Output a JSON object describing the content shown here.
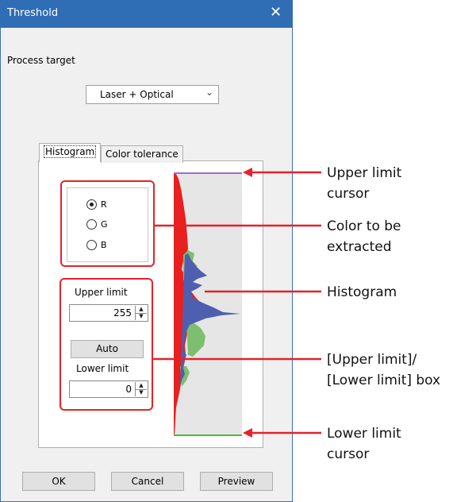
{
  "window": {
    "title": "Threshold"
  },
  "process_target": {
    "label": "Process target",
    "selected": "Laser + Optical"
  },
  "tabs": [
    {
      "label": "Histogram",
      "active": true
    },
    {
      "label": "Color tolerance",
      "active": false
    }
  ],
  "color_options": [
    {
      "label": "R",
      "selected": true
    },
    {
      "label": "G",
      "selected": false
    },
    {
      "label": "B",
      "selected": false
    }
  ],
  "upper_limit": {
    "label": "Upper limit",
    "value": "255"
  },
  "auto_button": "Auto",
  "lower_limit": {
    "label": "Lower limit",
    "value": "0"
  },
  "footer": {
    "ok": "OK",
    "cancel": "Cancel",
    "preview": "Preview"
  },
  "annotations": {
    "upper_cursor": [
      "Upper limit",
      "cursor"
    ],
    "color": [
      "Color to be",
      "extracted"
    ],
    "histogram": "Histogram",
    "limit_box": [
      "[Upper limit]/",
      "[Lower limit] box"
    ],
    "lower_cursor": [
      "Lower limit",
      "cursor"
    ]
  },
  "colors": {
    "accent": "#2f6db5",
    "annotation": "#e4232a",
    "red_channel": "#e8201f",
    "green_channel": "#7dbf6e",
    "blue_channel": "#4f5fb0",
    "upper_cursor": "#9b72c6",
    "lower_cursor": "#5bb04a"
  }
}
